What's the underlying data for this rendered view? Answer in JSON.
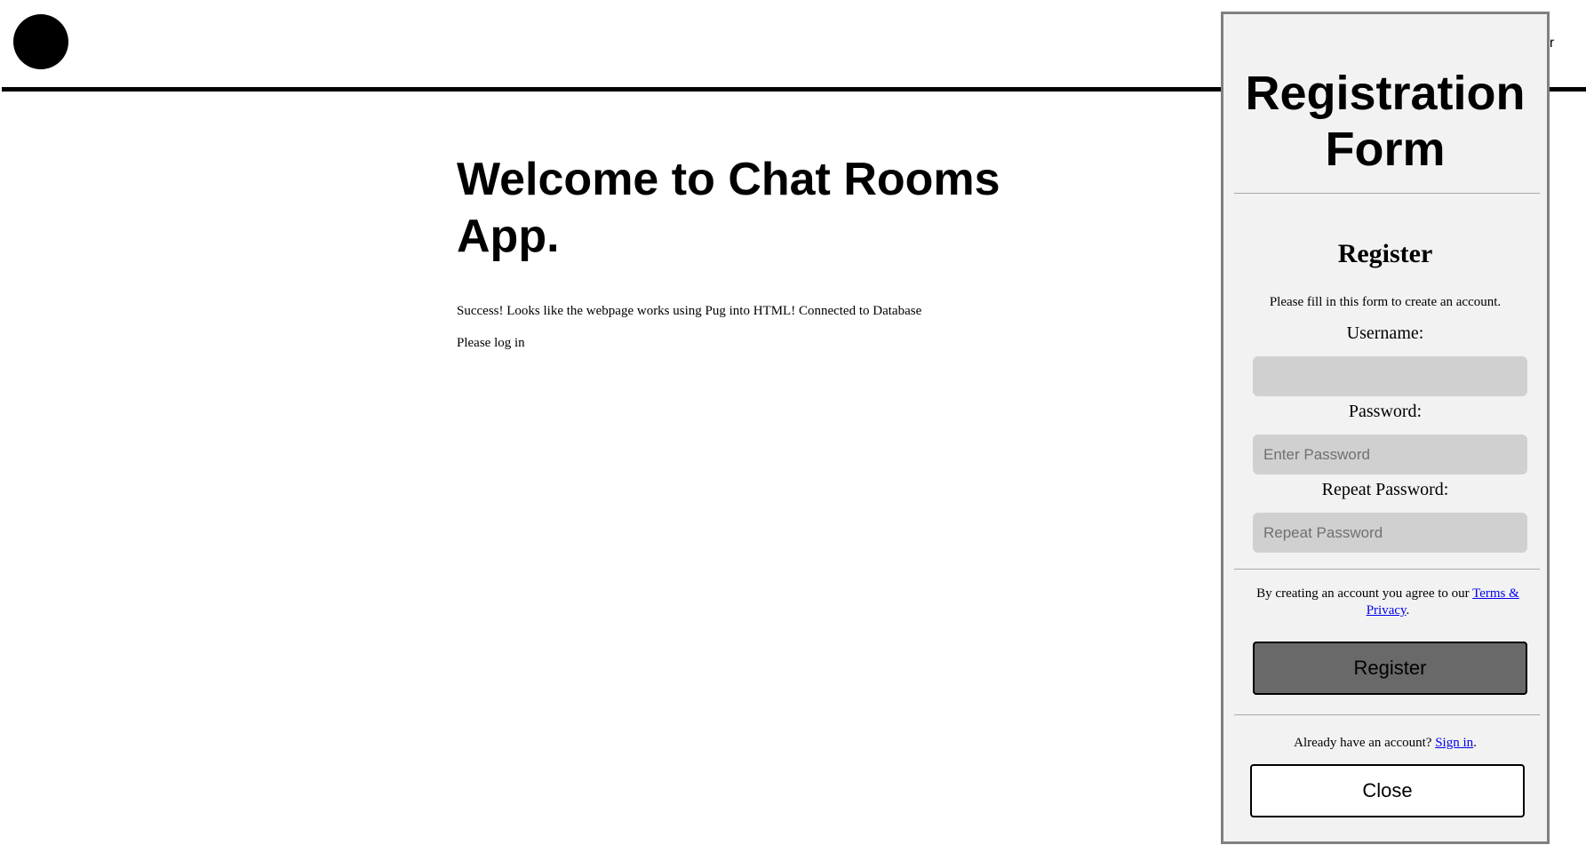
{
  "header": {
    "logo": "circle-logo",
    "nav_peek": "er"
  },
  "main": {
    "title": "Welcome to Chat Rooms App.",
    "success_text": "Success! Looks like the webpage works using Pug into HTML! Connected to Database",
    "login_text": "Please log in"
  },
  "modal": {
    "title": "Registration Form",
    "heading": "Register",
    "instructions": "Please fill in this form to create an account.",
    "username_label": "Username:",
    "username_value": "",
    "username_placeholder": "",
    "password_label": "Password:",
    "password_placeholder": "Enter Password",
    "repeat_label": "Repeat Password:",
    "repeat_placeholder": "Repeat Password",
    "terms_prefix": "By creating an account you agree to our ",
    "terms_link": "Terms & Privacy",
    "terms_suffix": ".",
    "register_button": "Register",
    "signin_prefix": "Already have an account? ",
    "signin_link": "Sign in",
    "signin_suffix": ".",
    "close_button": "Close"
  },
  "colors": {
    "modal_bg": "#f2f2f2",
    "input_bg": "#d0d0d0",
    "register_button_bg": "#696969",
    "link": "#0000ee"
  }
}
